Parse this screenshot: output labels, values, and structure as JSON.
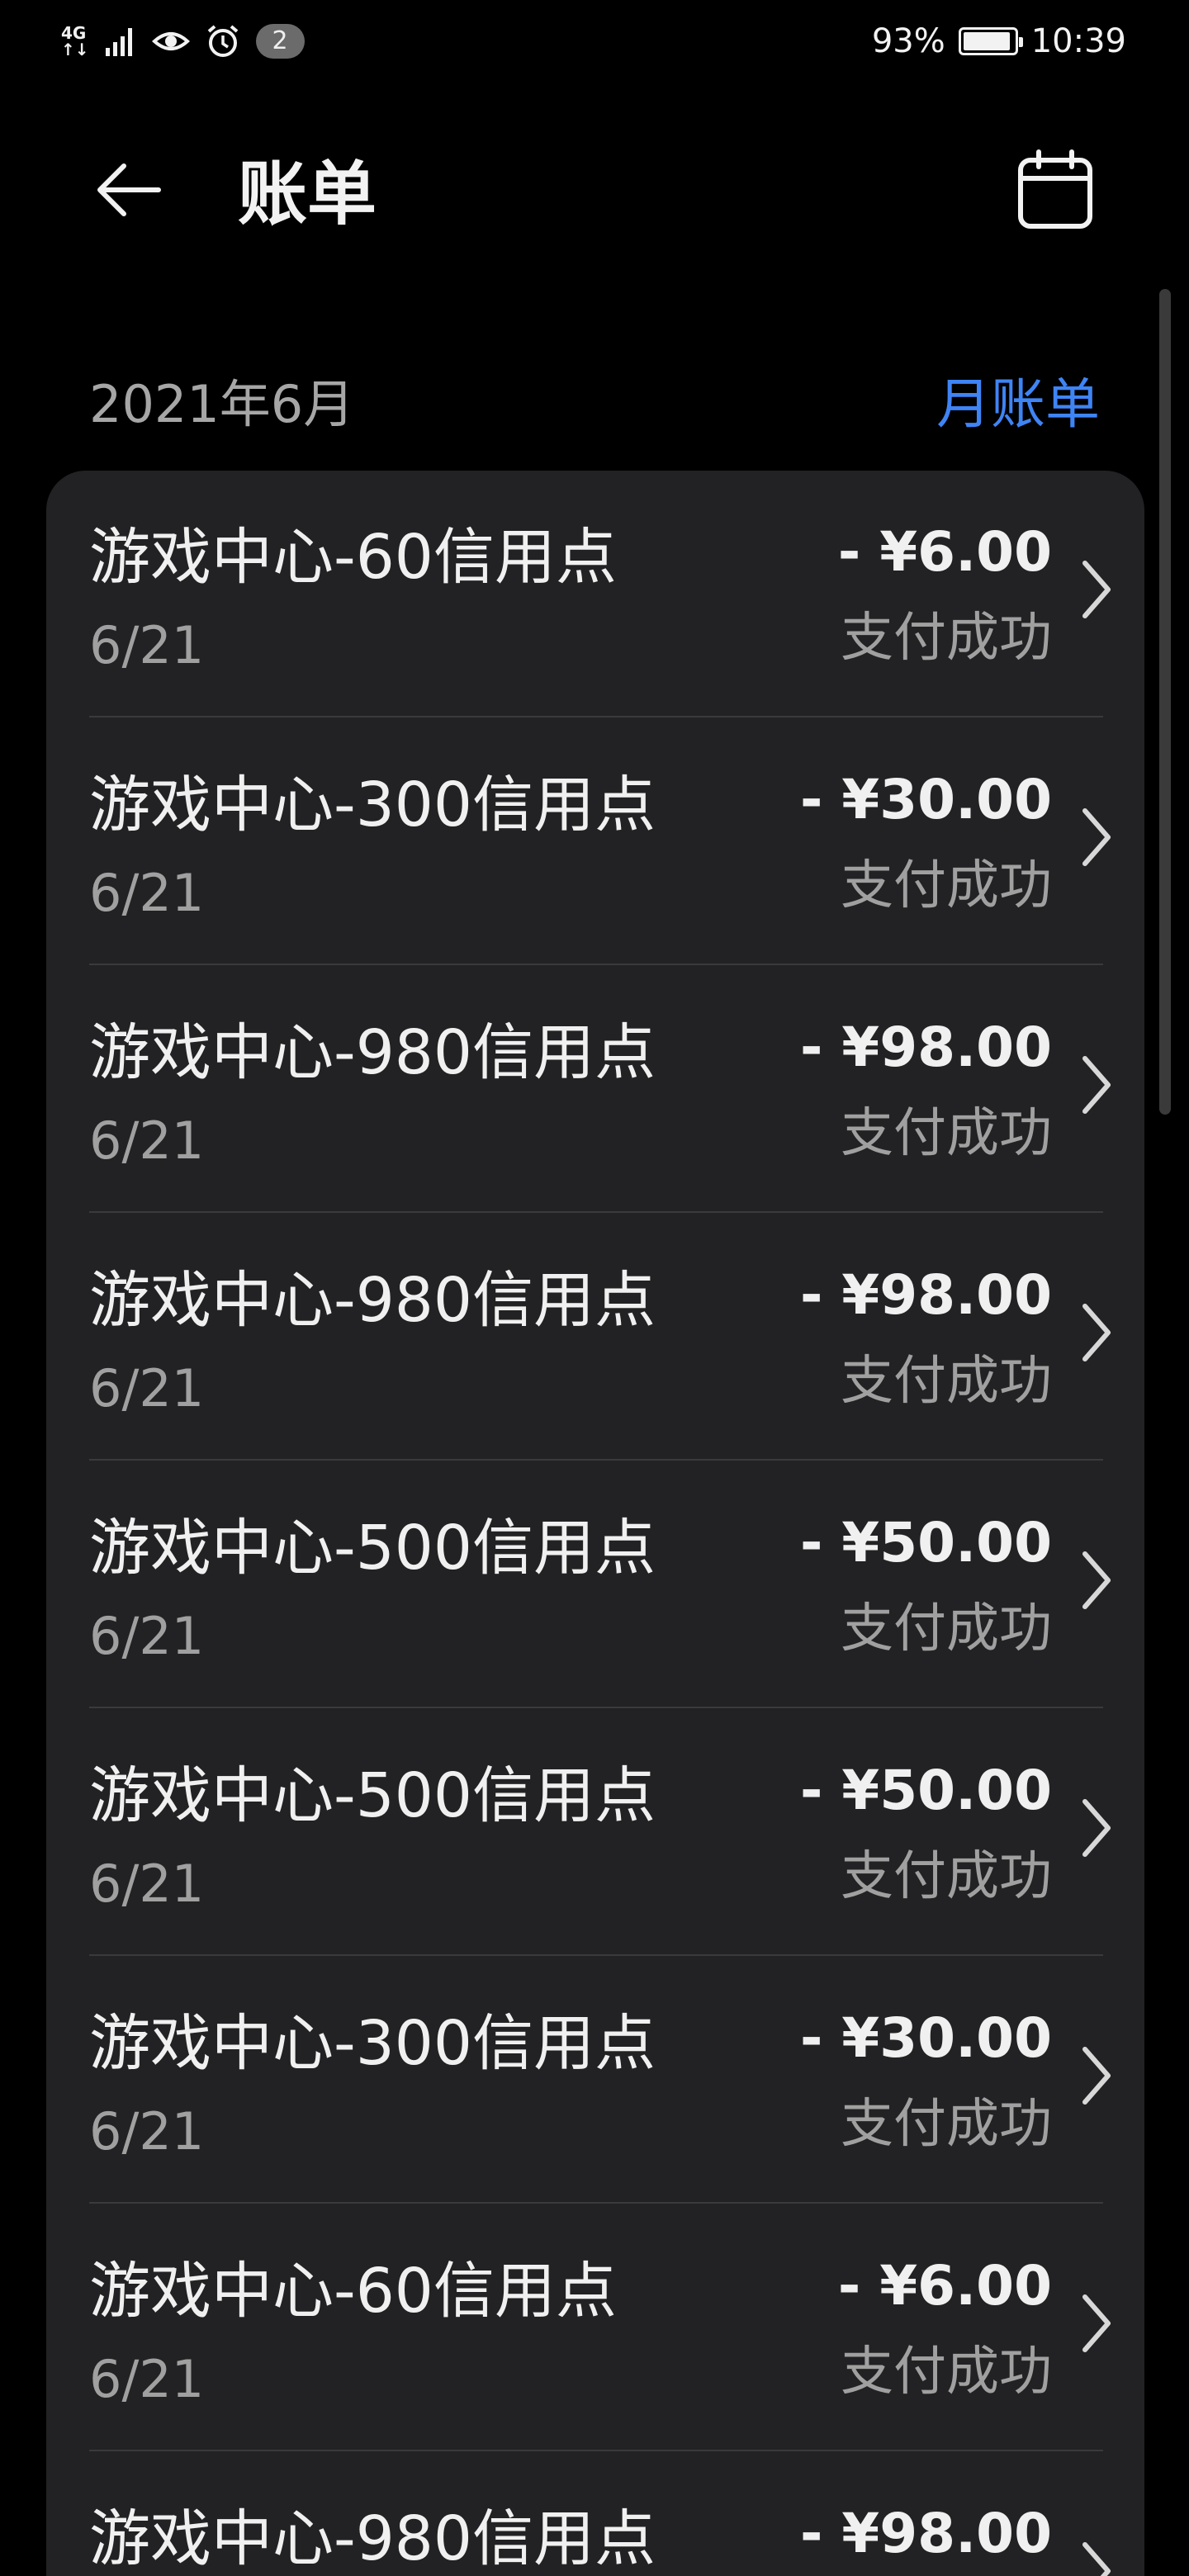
{
  "status_bar": {
    "network_top": "4G",
    "network_bottom": "↑↓",
    "notification_count": "2",
    "battery_percent": "93%",
    "battery_level": 0.93,
    "time": "10:39"
  },
  "header": {
    "title": "账单"
  },
  "section": {
    "month": "2021年6月",
    "monthly_bill_link": "月账单"
  },
  "transactions": [
    {
      "title": "游戏中心-60信用点",
      "date": "6/21",
      "amount": "- ¥6.00",
      "status": "支付成功"
    },
    {
      "title": "游戏中心-300信用点",
      "date": "6/21",
      "amount": "- ¥30.00",
      "status": "支付成功"
    },
    {
      "title": "游戏中心-980信用点",
      "date": "6/21",
      "amount": "- ¥98.00",
      "status": "支付成功"
    },
    {
      "title": "游戏中心-980信用点",
      "date": "6/21",
      "amount": "- ¥98.00",
      "status": "支付成功"
    },
    {
      "title": "游戏中心-500信用点",
      "date": "6/21",
      "amount": "- ¥50.00",
      "status": "支付成功"
    },
    {
      "title": "游戏中心-500信用点",
      "date": "6/21",
      "amount": "- ¥50.00",
      "status": "支付成功"
    },
    {
      "title": "游戏中心-300信用点",
      "date": "6/21",
      "amount": "- ¥30.00",
      "status": "支付成功"
    },
    {
      "title": "游戏中心-60信用点",
      "date": "6/21",
      "amount": "- ¥6.00",
      "status": "支付成功"
    },
    {
      "title": "游戏中心-980信用点",
      "date": "",
      "amount": "- ¥98.00",
      "status": ""
    }
  ],
  "colors": {
    "background": "#000000",
    "card": "#222224",
    "accent": "#3f84f5",
    "primary_text": "#f0f0f0",
    "secondary_text": "#a0a0a0"
  },
  "icons": {
    "back": "arrow-left-icon",
    "calendar": "calendar-icon",
    "row_chevron": "chevron-right-icon"
  }
}
